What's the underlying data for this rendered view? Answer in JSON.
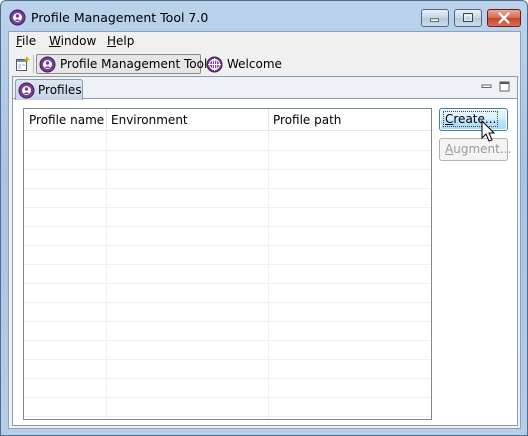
{
  "window": {
    "title": "Profile Management Tool 7.0"
  },
  "menu": {
    "file": {
      "mnemonic": "F",
      "rest": "ile"
    },
    "window": {
      "mnemonic": "W",
      "rest": "indow"
    },
    "help": {
      "mnemonic": "H",
      "rest": "elp"
    }
  },
  "toolbar": {
    "pmt_label": "Profile Management Tool",
    "welcome_label": "Welcome"
  },
  "view": {
    "tab_label": "Profiles"
  },
  "table": {
    "columns": [
      "Profile name",
      "Environment",
      "Profile path"
    ],
    "rows": []
  },
  "buttons": {
    "create": {
      "mnemonic": "C",
      "rest": "reate..."
    },
    "augment": {
      "mnemonic": "A",
      "rest": "ugment..."
    }
  },
  "colors": {
    "titlebar": "#b7cde8",
    "close_button": "#c2432a",
    "accent": "#3c7fb1"
  }
}
